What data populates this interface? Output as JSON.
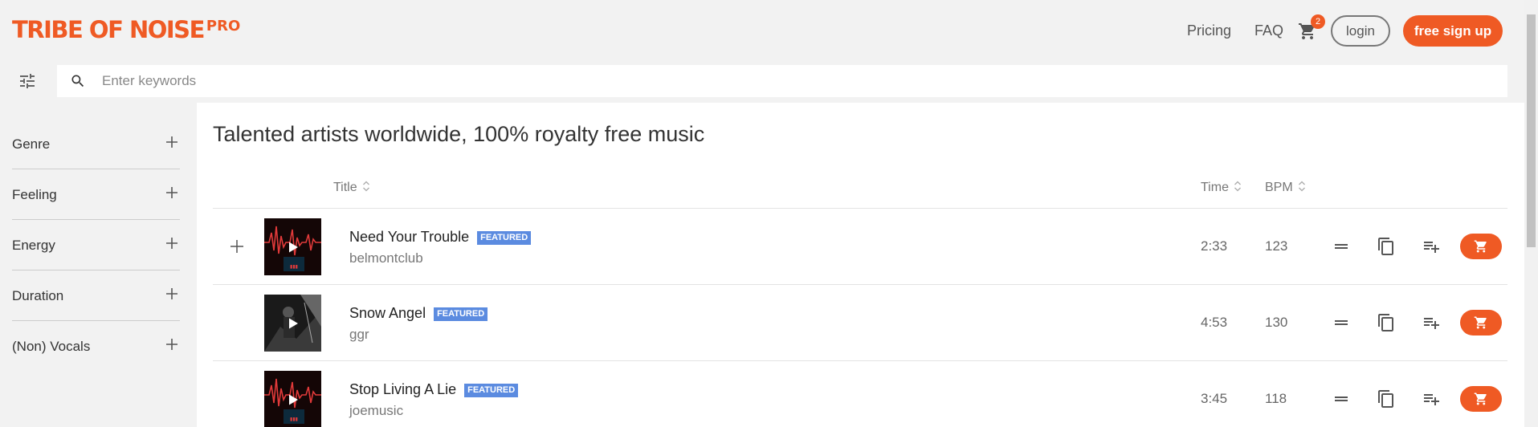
{
  "brand": {
    "logo_text": "TRIBE OF NOISE",
    "logo_suffix": "PRO",
    "accent": "#ef5a24"
  },
  "nav": {
    "pricing": "Pricing",
    "faq": "FAQ",
    "cart_count": "2",
    "login": "login",
    "signup": "free sign up"
  },
  "search": {
    "placeholder": "Enter keywords",
    "value": ""
  },
  "filters": [
    {
      "label": "Genre"
    },
    {
      "label": "Feeling"
    },
    {
      "label": "Energy"
    },
    {
      "label": "Duration"
    },
    {
      "label": "(Non) Vocals"
    }
  ],
  "main": {
    "title": "Talented artists worldwide, 100% royalty free music"
  },
  "table": {
    "columns": {
      "title": "Title",
      "time": "Time",
      "bpm": "BPM"
    },
    "badge": "FEATURED",
    "tracks": [
      {
        "title": "Need Your Trouble",
        "badge": "FEATURED",
        "artist": "belmontclub",
        "time": "2:33",
        "bpm": "123"
      },
      {
        "title": "Snow Angel",
        "badge": "FEATURED",
        "artist": "ggr",
        "time": "4:53",
        "bpm": "130"
      },
      {
        "title": "Stop Living A Lie",
        "badge": "FEATURED",
        "artist": "joemusic",
        "time": "3:45",
        "bpm": "118"
      }
    ]
  },
  "icons": {
    "filter_toggle": "tune-icon",
    "search": "search-icon",
    "cart": "cart-icon",
    "expand": "plus-icon",
    "play": "play-icon",
    "drag": "drag-handle-icon",
    "copy": "copy-icon",
    "playlist_add": "playlist-add-icon"
  },
  "colors": {
    "accent": "#ef5a24",
    "featured_badge": "#5b8be0",
    "background": "#f2f2f2"
  }
}
